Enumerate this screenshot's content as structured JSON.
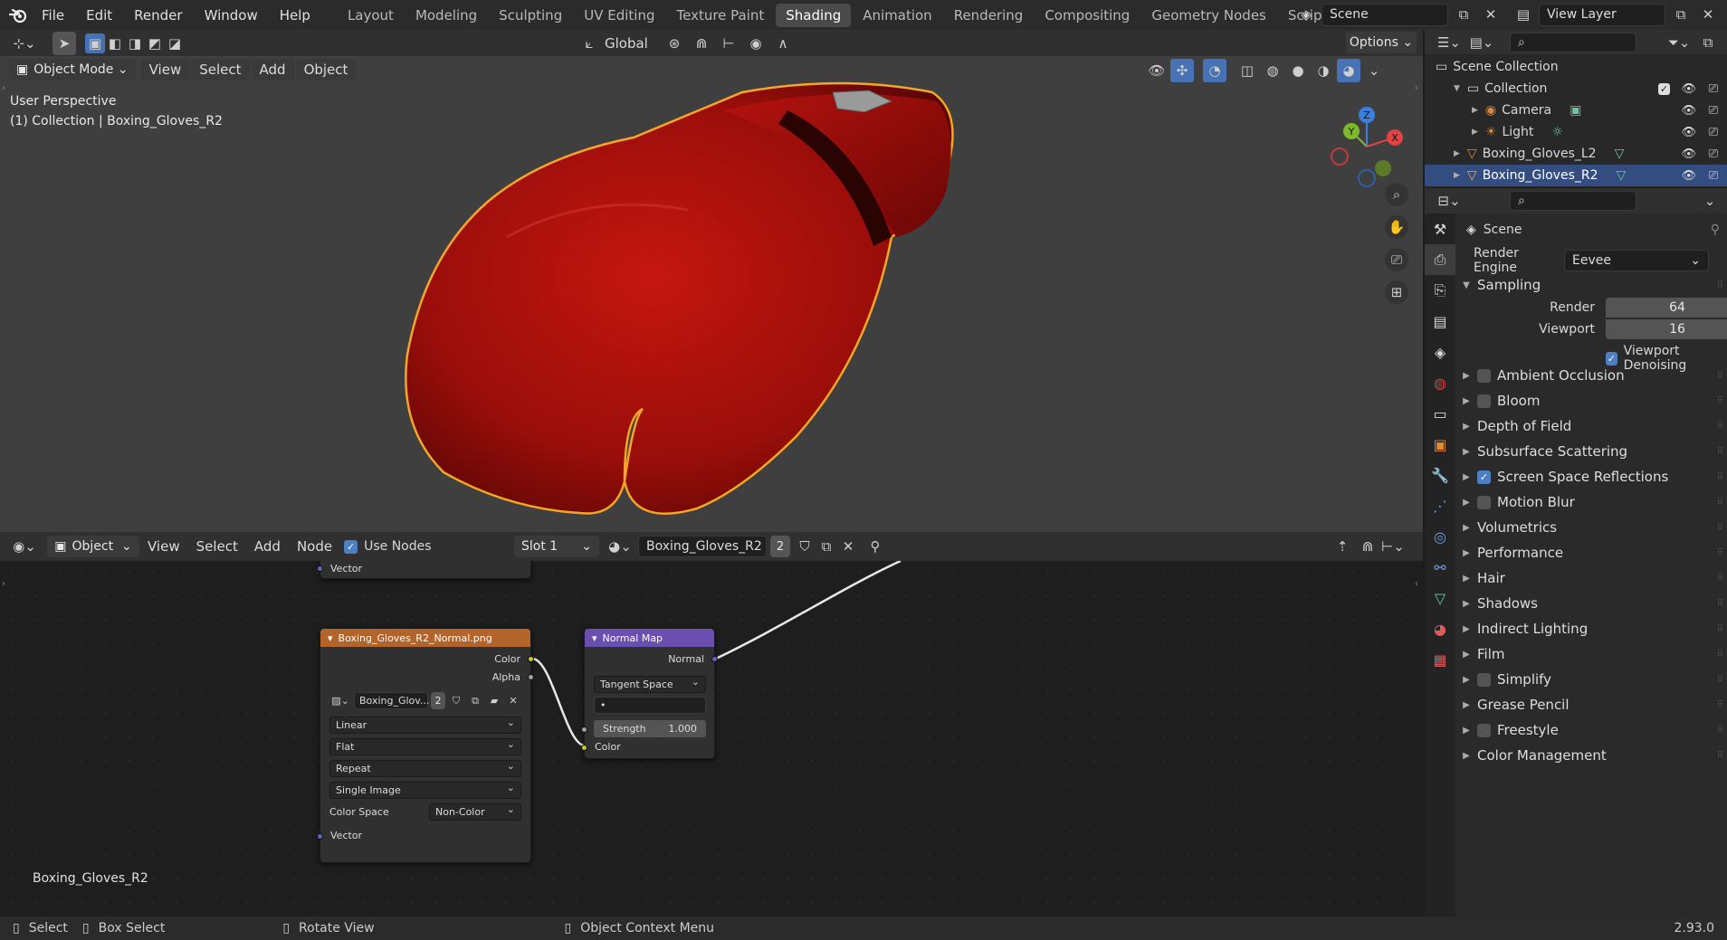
{
  "topbar": {
    "menus": [
      "File",
      "Edit",
      "Render",
      "Window",
      "Help"
    ],
    "workspaces": [
      "Layout",
      "Modeling",
      "Sculpting",
      "UV Editing",
      "Texture Paint",
      "Shading",
      "Animation",
      "Rendering",
      "Compositing",
      "Geometry Nodes",
      "Scripting"
    ],
    "active_workspace": "Shading",
    "scene": "Scene",
    "view_layer": "View Layer"
  },
  "toolbar": {
    "transform_orientation": "Global",
    "options_label": "Options"
  },
  "viewport": {
    "mode": "Object Mode",
    "menus": [
      "View",
      "Select",
      "Add",
      "Object"
    ],
    "perspective_label": "User Perspective",
    "collection_label": "(1) Collection | Boxing_Gloves_R2",
    "gizmo_axes": {
      "x": "X",
      "y": "Y",
      "z": "Z"
    }
  },
  "node_editor": {
    "editor_type": "Object",
    "menus": [
      "View",
      "Select",
      "Add",
      "Node"
    ],
    "use_nodes_label": "Use Nodes",
    "slot": "Slot 1",
    "material": "Boxing_Gloves_R2",
    "material_users": "2",
    "footer_label": "Boxing_Gloves_R2",
    "partial_node": {
      "output": "Vector"
    },
    "image_node": {
      "title": "Boxing_Gloves_R2_Normal.png",
      "outputs": [
        "Color",
        "Alpha"
      ],
      "image_name": "Boxing_Glov...",
      "image_users": "2",
      "interpolation": "Linear",
      "projection": "Flat",
      "extension": "Repeat",
      "source": "Single Image",
      "color_space_label": "Color Space",
      "color_space": "Non-Color",
      "input": "Vector"
    },
    "normal_map_node": {
      "title": "Normal Map",
      "output": "Normal",
      "space": "Tangent Space",
      "uv_map": "•",
      "strength_label": "Strength",
      "strength_value": "1.000",
      "input": "Color"
    }
  },
  "outliner": {
    "root": "Scene Collection",
    "items": [
      {
        "label": "Collection",
        "depth": 1
      },
      {
        "label": "Camera",
        "depth": 2
      },
      {
        "label": "Light",
        "depth": 2
      },
      {
        "label": "Boxing_Gloves_L2",
        "depth": 1
      },
      {
        "label": "Boxing_Gloves_R2",
        "depth": 1,
        "selected": true
      }
    ]
  },
  "properties": {
    "context": "Scene",
    "render_engine_label": "Render Engine",
    "render_engine": "Eevee",
    "sampling": {
      "title": "Sampling",
      "render_label": "Render",
      "render_value": "64",
      "viewport_label": "Viewport",
      "viewport_value": "16",
      "denoise_label": "Viewport Denoising"
    },
    "panels": [
      {
        "label": "Ambient Occlusion",
        "checkbox": true,
        "checked": false
      },
      {
        "label": "Bloom",
        "checkbox": true,
        "checked": false
      },
      {
        "label": "Depth of Field",
        "checkbox": false
      },
      {
        "label": "Subsurface Scattering",
        "checkbox": false
      },
      {
        "label": "Screen Space Reflections",
        "checkbox": true,
        "checked": true
      },
      {
        "label": "Motion Blur",
        "checkbox": true,
        "checked": false
      },
      {
        "label": "Volumetrics",
        "checkbox": false
      },
      {
        "label": "Performance",
        "checkbox": false
      },
      {
        "label": "Hair",
        "checkbox": false
      },
      {
        "label": "Shadows",
        "checkbox": false
      },
      {
        "label": "Indirect Lighting",
        "checkbox": false
      },
      {
        "label": "Film",
        "checkbox": false
      },
      {
        "label": "Simplify",
        "checkbox": true,
        "checked": false
      },
      {
        "label": "Grease Pencil",
        "checkbox": false
      },
      {
        "label": "Freestyle",
        "checkbox": true,
        "checked": false
      },
      {
        "label": "Color Management",
        "checkbox": false
      }
    ]
  },
  "statusbar": {
    "select": "Select",
    "box_select": "Box Select",
    "rotate_view": "Rotate View",
    "context_menu": "Object Context Menu",
    "version": "2.93.0"
  },
  "colors": {
    "accent": "#4772b3",
    "glove": "#a8100c",
    "selection_outline": "#f5a623",
    "image_node_header": "#b3642a",
    "vector_node_header": "#6a4fb0"
  }
}
